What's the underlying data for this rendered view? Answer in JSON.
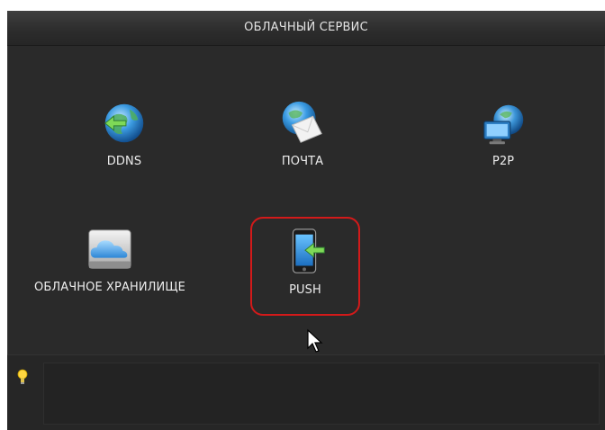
{
  "window": {
    "title": "ОБЛАЧНЫЙ СЕРВИС"
  },
  "tiles": [
    {
      "label": "DDNS",
      "icon": "ddns-globe-icon",
      "selected": false
    },
    {
      "label": "ПОЧТА",
      "icon": "mail-globe-icon",
      "selected": false
    },
    {
      "label": "P2P",
      "icon": "p2p-network-icon",
      "selected": false
    },
    {
      "label": "ОБЛАЧНОЕ ХРАНИЛИЩЕ",
      "icon": "cloud-storage-icon",
      "selected": false
    },
    {
      "label": "PUSH",
      "icon": "push-phone-icon",
      "selected": true
    }
  ],
  "colors": {
    "background": "#2a2a2a",
    "text": "#ededed",
    "selection": "#d21a1a"
  },
  "info": {
    "icon": "lightbulb-icon"
  }
}
